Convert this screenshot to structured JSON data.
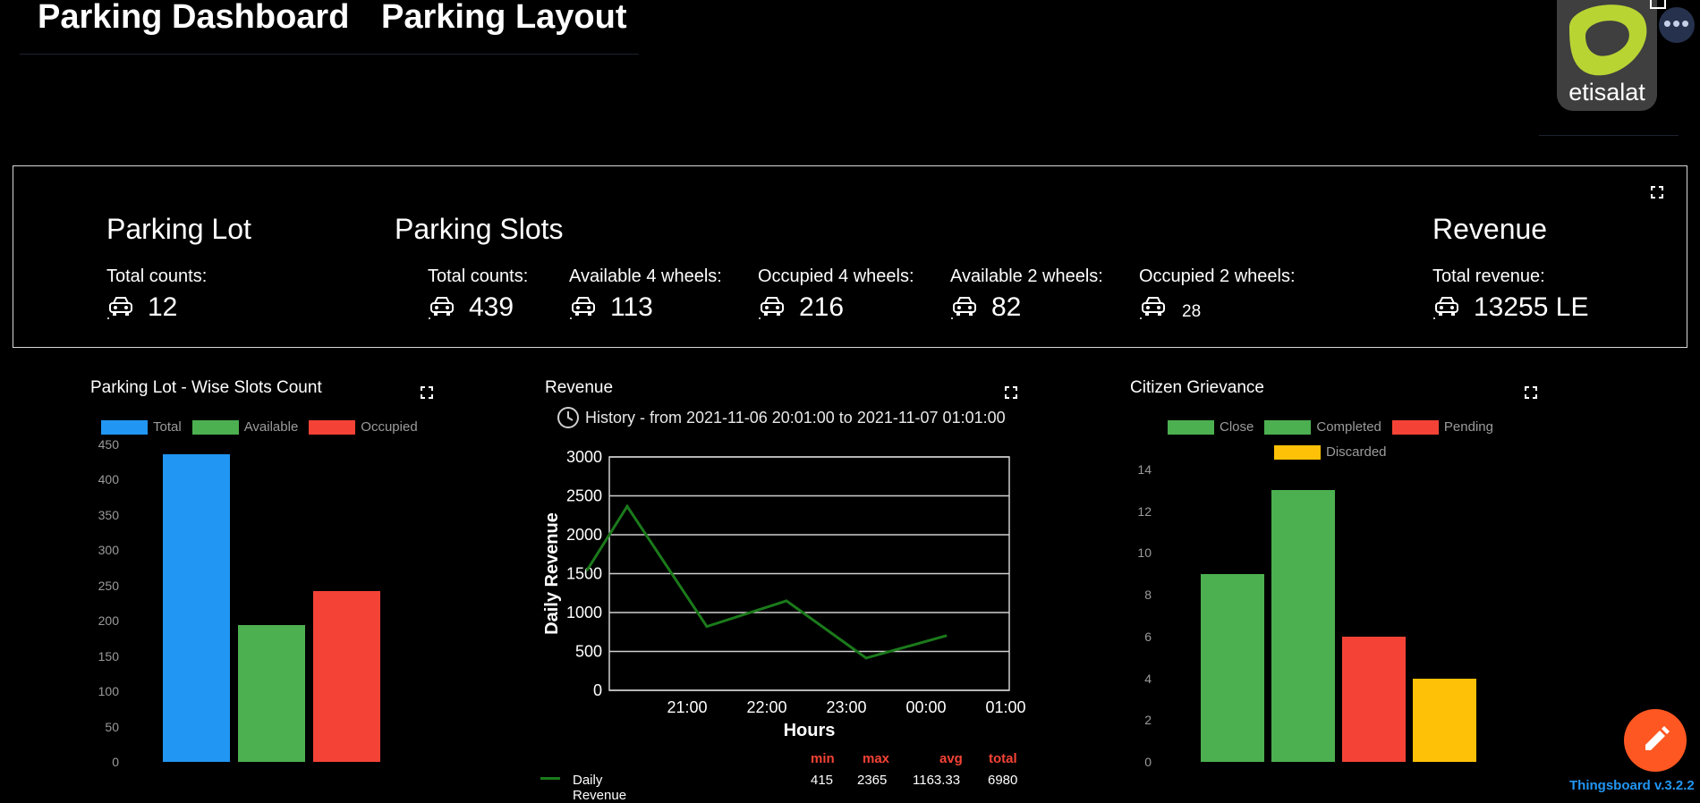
{
  "header": {
    "tabs": [
      {
        "label": "Parking Dashboard"
      },
      {
        "label": "Parking Layout"
      }
    ],
    "logo_text": "etisalat",
    "menu_label": "•••"
  },
  "stats": {
    "parking_lot": {
      "title": "Parking Lot",
      "items": [
        {
          "label": "Total counts:",
          "value": "12"
        }
      ]
    },
    "parking_slots": {
      "title": "Parking Slots",
      "items": [
        {
          "label": "Total counts:",
          "value": "439"
        },
        {
          "label": "Available 4 wheels:",
          "value": "113"
        },
        {
          "label": "Occupied 4 wheels:",
          "value": "216"
        },
        {
          "label": "Available 2 wheels:",
          "value": "82"
        },
        {
          "label": "Occupied 2 wheels:",
          "value": "28"
        }
      ]
    },
    "revenue": {
      "title": "Revenue",
      "items": [
        {
          "label": "Total revenue:",
          "value": "13255 LE"
        }
      ]
    }
  },
  "widgets": {
    "lot_wise": {
      "title": "Parking Lot - Wise Slots Count",
      "legend": [
        "Total",
        "Available",
        "Occupied"
      ]
    },
    "revenue": {
      "title": "Revenue",
      "history": "History - from 2021-11-06 20:01:00 to 2021-11-07 01:01:00",
      "table_headers": [
        "min",
        "max",
        "avg",
        "total"
      ],
      "table_row": {
        "name": "Daily Revenue",
        "values": [
          "415",
          "2365",
          "1163.33",
          "6980"
        ]
      }
    },
    "grievance": {
      "title": "Citizen Grievance",
      "legend": [
        "Close",
        "Completed",
        "Pending",
        "Discarded"
      ]
    }
  },
  "colors": {
    "total": "#2196f3",
    "available": "#4caf50",
    "occupied": "#f44336",
    "discarded": "#ffc107",
    "line": "#1b7a1b",
    "header_red": "#f44336",
    "fab": "#ff5722",
    "version": "#2196f3"
  },
  "chart_data": [
    {
      "type": "bar",
      "title": "Parking Lot - Wise Slots Count",
      "categories": [
        "Total",
        "Available",
        "Occupied"
      ],
      "values": [
        436,
        194,
        242
      ],
      "ylim": [
        0,
        450
      ],
      "yticks": [
        0,
        50,
        100,
        150,
        200,
        250,
        300,
        350,
        400,
        450
      ],
      "grid": false,
      "legend": "top"
    },
    {
      "type": "line",
      "title": "",
      "xlabel": "Hours",
      "ylabel": "Daily Revenue",
      "x": [
        "20:01",
        "20:31",
        "21:31",
        "22:31",
        "23:31",
        "00:31",
        "01:01"
      ],
      "xticks": [
        "21:00",
        "22:00",
        "23:00",
        "00:00",
        "01:00"
      ],
      "series": [
        {
          "name": "Daily Revenue",
          "values": [
            1550,
            2365,
            820,
            1150,
            415,
            700
          ]
        }
      ],
      "ylim": [
        0,
        3000
      ],
      "yticks": [
        0,
        500,
        1000,
        1500,
        2000,
        2500,
        3000
      ],
      "grid": true,
      "legend": "bottom"
    },
    {
      "type": "bar",
      "title": "Citizen Grievance",
      "categories": [
        "Close",
        "Completed",
        "Pending",
        "Discarded"
      ],
      "values": [
        9,
        13,
        6,
        4
      ],
      "ylim": [
        0,
        14
      ],
      "yticks": [
        0,
        2,
        4,
        6,
        8,
        10,
        12,
        14
      ],
      "grid": false,
      "legend": "top"
    }
  ],
  "footer": {
    "version": "Thingsboard v.3.2.2"
  }
}
